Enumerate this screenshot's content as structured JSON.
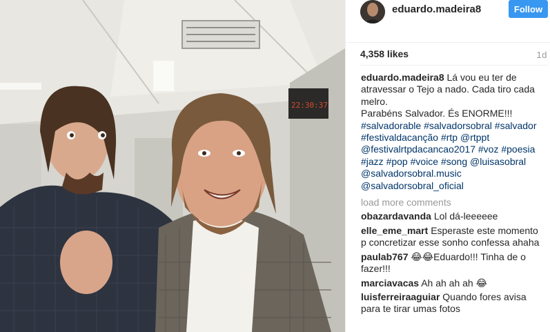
{
  "post": {
    "username": "eduardo.madeira8",
    "follow_label": "Follow",
    "likes": "4,358 likes",
    "time": "1d",
    "caption": {
      "username": "eduardo.madeira8",
      "line1": "Lá vou eu ter de atravessar o Tejo a nado. Cada tiro cada melro.",
      "line2": "Parabéns Salvador. És ENORME!!!",
      "hashtags": [
        "#salvadorable",
        "#salvadorsobral",
        "#salvador",
        "#festivaldacanção",
        "#rtp",
        "@rtppt",
        "@festivalrtpdacancao2017",
        "#voz",
        "#poesia",
        "#jazz",
        "#pop",
        "#voice",
        "#song",
        "@luisasobral",
        "@salvadorsobral.music",
        "@salvadorsobral_oficial"
      ]
    },
    "load_more": "load more comments",
    "comments": [
      {
        "user": "obazardavanda",
        "text": "Lol dá-leeeeee"
      },
      {
        "user": "elle_eme_mart",
        "text": "Esperaste este momento p concretizar esse sonho confessa ahaha"
      },
      {
        "user": "paulab767",
        "text": "😂😂Eduardo!!! Tinha de o fazer!!!"
      },
      {
        "user": "marciavacas",
        "text": "Ah ah ah ah 😂"
      },
      {
        "user": "luisferreiraaguiar",
        "text": "Quando fores avisa para te tirar umas fotos"
      }
    ]
  },
  "photo": {
    "clock_text": "22:30:37"
  },
  "colors": {
    "follow_button": "#3897f0",
    "link": "#003569",
    "muted": "#999999",
    "text": "#262626"
  }
}
